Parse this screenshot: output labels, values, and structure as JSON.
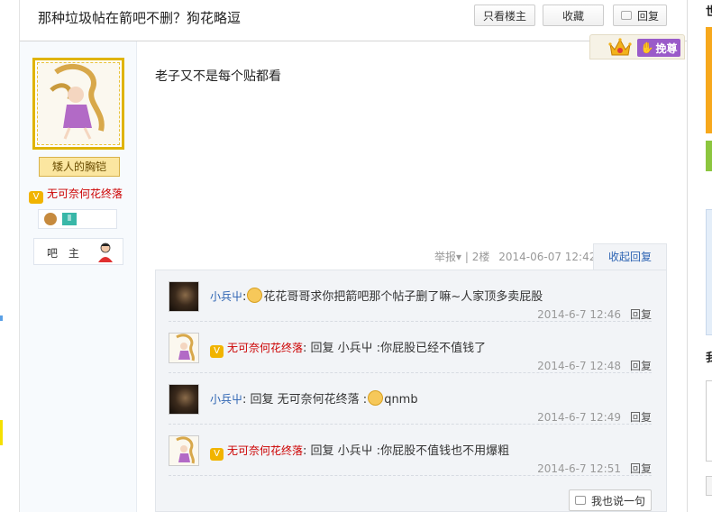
{
  "thread": {
    "title": "那种垃圾帖在箭吧不删？狗花略逗"
  },
  "toolbar": {
    "only_louzhu": "只看楼主",
    "favorite": "收藏",
    "reply": "回复"
  },
  "badge": {
    "tiebei_label": "挽尊"
  },
  "author": {
    "tag": "矮人的胸铠",
    "vip_name": "无可奈何花终落",
    "vip_icon": "V",
    "bazhu_label": "吧 主"
  },
  "post": {
    "content": "老子又不是每个贴都看",
    "report": "举报",
    "separator": "|",
    "floor": "2楼",
    "time": "2014-06-07 12:42",
    "fold_label": "收起回复"
  },
  "replies": [
    {
      "user": "小兵屮",
      "vip": false,
      "has_emoji": true,
      "text": "花花哥哥求你把箭吧那个帖子删了嘛~人家顶多卖屁股",
      "time": "2014-6-7 12:46",
      "reply_label": "回复"
    },
    {
      "user": "无可奈何花终落",
      "vip": true,
      "has_emoji": false,
      "text": "回复 小兵屮 :你屁股已经不值钱了",
      "time": "2014-6-7 12:48",
      "reply_label": "回复"
    },
    {
      "user": "小兵屮",
      "vip": false,
      "has_emoji": true,
      "text_before": "回复 无可奈何花终落 :",
      "text": "qnmb",
      "time": "2014-6-7 12:49",
      "reply_label": "回复"
    },
    {
      "user": "无可奈何花终落",
      "vip": true,
      "has_emoji": false,
      "text": "回复 小兵屮 :你屁股不值钱也不用爆粗",
      "time": "2014-6-7 12:51",
      "reply_label": "回复"
    }
  ],
  "say_button": "我也说一句",
  "right_panel": {
    "head1": "世",
    "head2": "我"
  },
  "colors": {
    "link_blue": "#2d64b3",
    "vip_red": "#cc0000",
    "tiebei_purple": "#9a5bc9",
    "gold": "#e0b400"
  }
}
